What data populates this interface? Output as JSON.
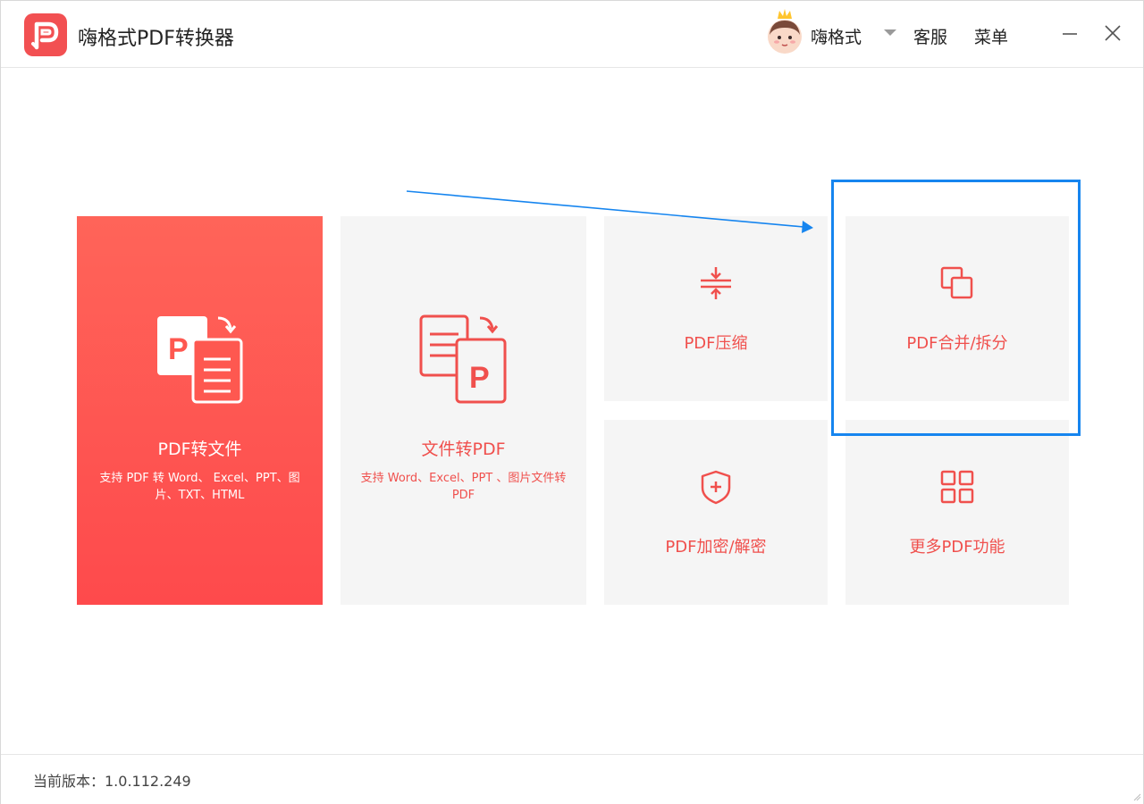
{
  "app": {
    "title": "嗨格式PDF转换器",
    "brand_color": "#f25052",
    "accent_text_color": "#f0504d"
  },
  "header": {
    "user_name": "嗨格式",
    "service_label": "客服",
    "menu_label": "菜单"
  },
  "cards": {
    "pdf_to_file": {
      "title": "PDF转文件",
      "desc": "支持 PDF 转 Word、 Excel、PPT、图片、TXT、HTML",
      "icon": "pdf-to-file-icon"
    },
    "file_to_pdf": {
      "title": "文件转PDF",
      "desc": "支持 Word、Excel、PPT 、图片文件转 PDF",
      "icon": "file-to-pdf-icon"
    },
    "compress": {
      "title": "PDF压缩",
      "icon": "compress-icon"
    },
    "merge_split": {
      "title": "PDF合并/拆分",
      "icon": "merge-icon"
    },
    "encrypt": {
      "title": "PDF加密/解密",
      "icon": "shield-plus-icon"
    },
    "more": {
      "title": "更多PDF功能",
      "icon": "grid-icon"
    }
  },
  "annotation": {
    "highlight_color": "#1685ef"
  },
  "footer": {
    "version_text": "当前版本：1.0.112.249"
  }
}
